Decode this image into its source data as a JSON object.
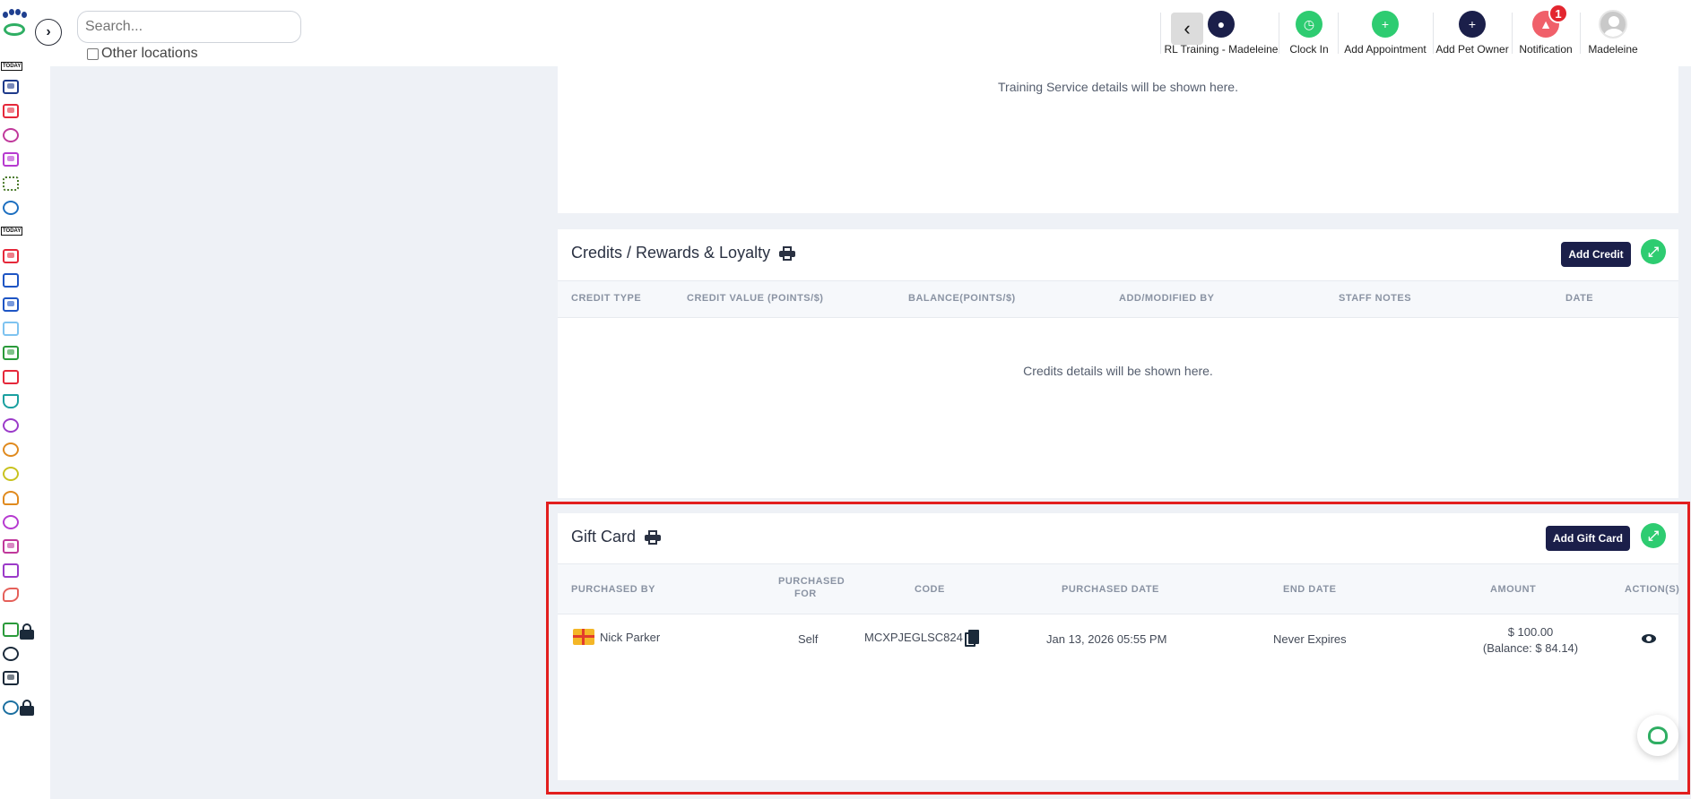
{
  "topbar": {
    "search_placeholder": "Search...",
    "other_locations": "Other locations",
    "items": [
      {
        "label": "RL Training - Madeleine",
        "icon": "location-pin-icon",
        "color": "#1b1f4a"
      },
      {
        "label": "Clock In",
        "icon": "clock-icon",
        "color": "#2ecc71"
      },
      {
        "label": "Add Appointment",
        "icon": "calendar-plus-icon",
        "color": "#2ecc71"
      },
      {
        "label": "Add Pet Owner",
        "icon": "add-user-icon",
        "color": "#1b1f4a"
      },
      {
        "label": "Notification",
        "icon": "bell-icon",
        "color": "#f0606a",
        "badge": "1"
      },
      {
        "label": "Madeleine",
        "icon": "avatar"
      }
    ]
  },
  "training": {
    "empty_text": "Training Service details will be shown here."
  },
  "credits": {
    "title": "Credits / Rewards & Loyalty",
    "add_button": "Add Credit",
    "columns": [
      "CREDIT TYPE",
      "CREDIT VALUE (POINTS/$)",
      "BALANCE(POINTS/$)",
      "ADD/MODIFIED BY",
      "STAFF NOTES",
      "DATE"
    ],
    "empty_text": "Credits details will be shown here."
  },
  "gift_card": {
    "title": "Gift Card",
    "add_button": "Add Gift Card",
    "columns": {
      "purchased_by": "PURCHASED BY",
      "purchased_for_1": "PURCHASED",
      "purchased_for_2": "FOR",
      "code": "CODE",
      "purchased_date": "PURCHASED DATE",
      "end_date": "END DATE",
      "amount": "AMOUNT",
      "actions": "ACTION(S)"
    },
    "rows": [
      {
        "purchased_by": "Nick Parker",
        "purchased_for": "Self",
        "code": "MCXPJEGLSC824",
        "purchased_date": "Jan 13, 2026 05:55 PM",
        "end_date": "Never Expires",
        "amount": "$ 100.00",
        "balance": "(Balance: $ 84.14)"
      }
    ]
  },
  "sidebar": {
    "today_label": "TODAY"
  }
}
